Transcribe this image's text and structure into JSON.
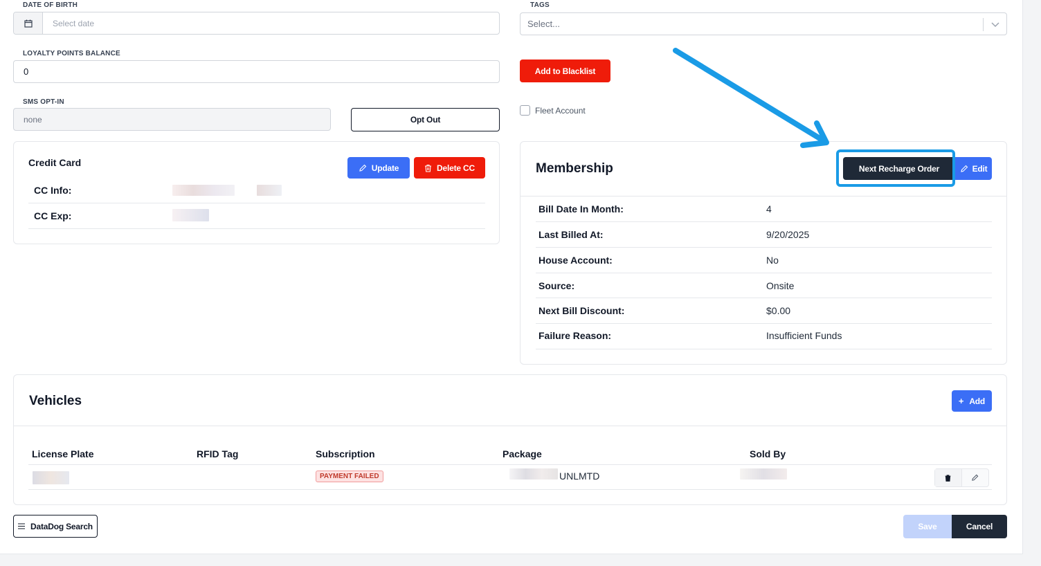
{
  "form": {
    "dob": {
      "label": "DATE OF BIRTH",
      "placeholder": "Select date",
      "icon": "calendar-icon"
    },
    "tags": {
      "label": "TAGS",
      "placeholder": "Select...",
      "icon": "chevron-down-icon"
    },
    "loyalty": {
      "label": "LOYALTY POINTS BALANCE",
      "value": "0"
    },
    "blacklist_button": "Add to Blacklist",
    "sms": {
      "label": "SMS OPT-IN",
      "value": "none",
      "opt_out_button": "Opt Out"
    },
    "fleet_account": {
      "label": "Fleet Account",
      "checked": false
    }
  },
  "credit_card": {
    "title": "Credit Card",
    "update_button": "Update",
    "delete_button": "Delete CC",
    "rows": [
      {
        "label": "CC Info:"
      },
      {
        "label": "CC Exp:"
      }
    ]
  },
  "membership": {
    "title": "Membership",
    "next_recharge_button": "Next Recharge Order",
    "edit_button": "Edit",
    "rows": [
      {
        "label": "Bill Date In Month:",
        "value": "4"
      },
      {
        "label": "Last Billed At:",
        "value": "9/20/2025"
      },
      {
        "label": "House Account:",
        "value": "No"
      },
      {
        "label": "Source:",
        "value": "Onsite"
      },
      {
        "label": "Next Bill Discount:",
        "value": "$0.00"
      },
      {
        "label": "Failure Reason:",
        "value": "Insufficient Funds"
      }
    ]
  },
  "vehicles": {
    "title": "Vehicles",
    "add_button": "Add",
    "columns": [
      "License Plate",
      "RFID Tag",
      "Subscription",
      "Package",
      "Sold By"
    ],
    "rows": [
      {
        "subscription_badge": "PAYMENT FAILED",
        "package_suffix": "UNLMTD"
      }
    ]
  },
  "footer": {
    "datadog_button": "DataDog Search",
    "save_button": "Save",
    "cancel_button": "Cancel"
  },
  "colors": {
    "primary_blue": "#3b6ef6",
    "danger_red": "#ef1c0a",
    "dark": "#1f2937",
    "annotation_blue": "#1a9be6"
  }
}
